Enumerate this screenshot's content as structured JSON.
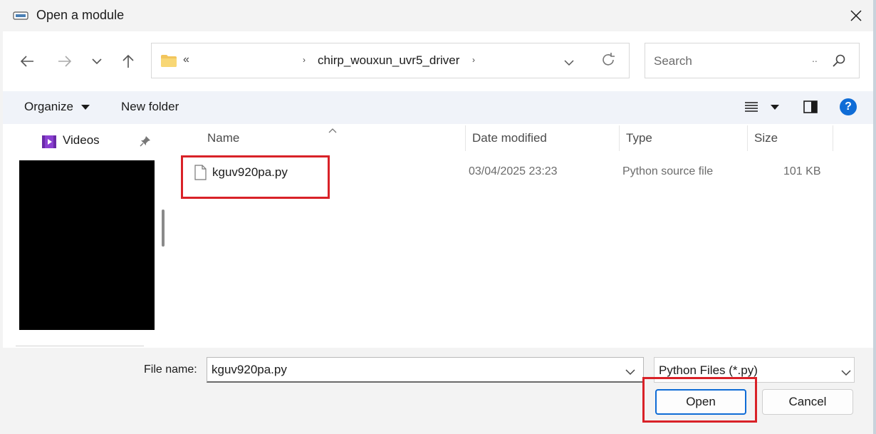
{
  "window": {
    "title": "Open a module",
    "close_icon": "close-icon",
    "app_icon": "python-module-icon"
  },
  "nav": {
    "back_icon": "arrow-left-icon",
    "forward_icon": "arrow-right-icon",
    "recent_icon": "chevron-down-icon",
    "up_icon": "arrow-up-icon"
  },
  "address": {
    "overflow": "«",
    "breadcrumb": "chirp_wouxun_uvr5_driver",
    "folder_icon": "folder-icon",
    "dropdown_icon": "chevron-down-icon",
    "refresh_icon": "refresh-icon"
  },
  "search": {
    "placeholder": "Search",
    "dots": "..",
    "icon": "search-icon"
  },
  "toolbar": {
    "organize": "Organize",
    "new_folder": "New folder",
    "view_icon": "list-view-icon",
    "preview_icon": "preview-pane-icon",
    "help": "?"
  },
  "navpane": {
    "items": [
      {
        "label": "Videos",
        "icon": "videos-icon",
        "pinned": true
      }
    ]
  },
  "filelist": {
    "columns": [
      "Name",
      "Date modified",
      "Type",
      "Size"
    ],
    "rows": [
      {
        "name": "kguv920pa.py",
        "date": "03/04/2025 23:23",
        "type": "Python source file",
        "size": "101 KB"
      }
    ]
  },
  "bottom": {
    "file_name_label": "File name:",
    "file_name_value": "kguv920pa.py",
    "filter": "Python Files (*.py)",
    "open": "Open",
    "cancel": "Cancel"
  },
  "colors": {
    "accent": "#0f6cd6",
    "highlight": "#d92228",
    "folder": "#f2c55c",
    "videos": "#8a3fd1"
  }
}
